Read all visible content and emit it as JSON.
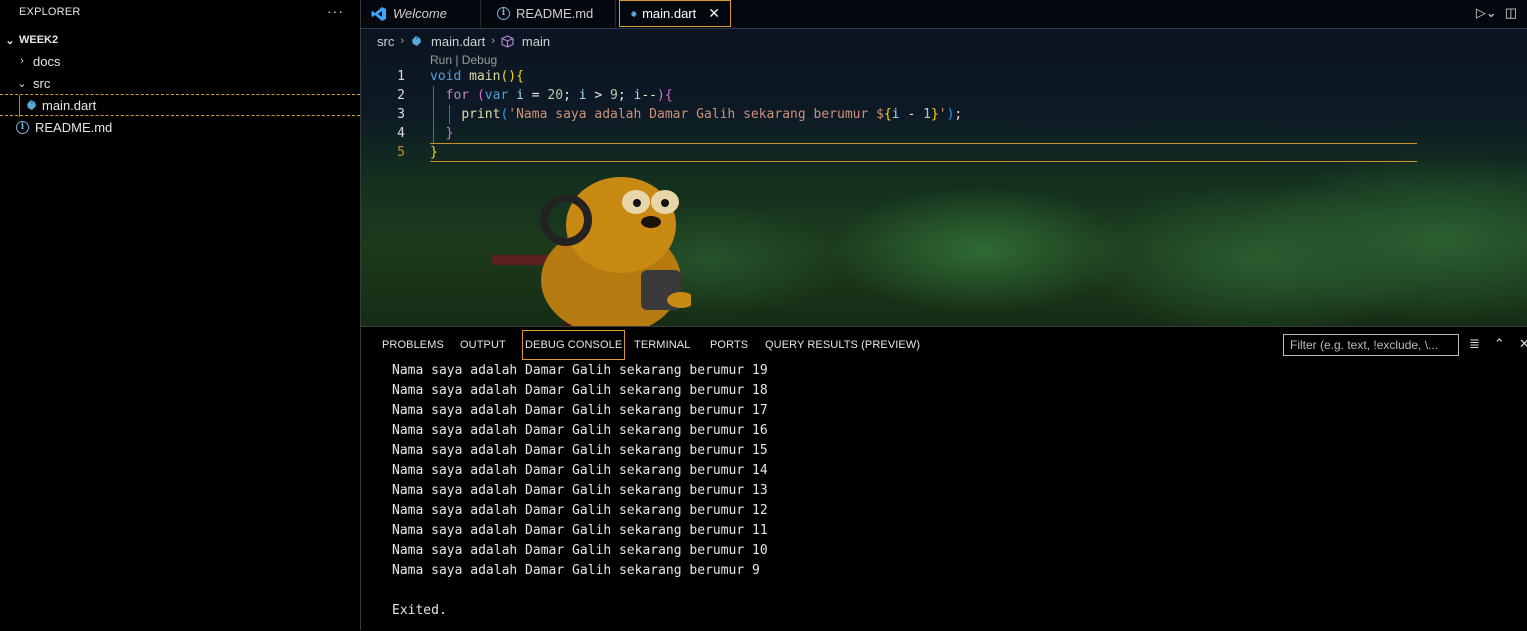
{
  "sidebar": {
    "title": "EXPLORER",
    "more": "···",
    "root": "WEEK2",
    "items": [
      {
        "label": "docs"
      },
      {
        "label": "src"
      },
      {
        "label": "main.dart"
      },
      {
        "label": "README.md"
      }
    ]
  },
  "tabs": [
    {
      "label": "Welcome"
    },
    {
      "label": "README.md"
    },
    {
      "label": "main.dart",
      "close": "✕"
    }
  ],
  "breadcrumb": {
    "folder": "src",
    "file": "main.dart",
    "symbol": "main"
  },
  "editor": {
    "codelens": "Run | Debug",
    "line_numbers": [
      "1",
      "2",
      "3",
      "4",
      "5"
    ],
    "code": {
      "l1_kw": "void",
      "l1_fn": "main",
      "l1_open": "()",
      "l1_brace": "{",
      "l2_kw": "for",
      "l2_p1": "(",
      "l2_var": "var",
      "l2_i": "i",
      "l2_eq": " = ",
      "l2_n1": "20",
      "l2_semi1": "; ",
      "l2_i2": "i",
      "l2_gt": " > ",
      "l2_n2": "9",
      "l2_semi2": "; ",
      "l2_i3": "i",
      "l2_dec": "--",
      "l2_p2": ")",
      "l2_brace": "{",
      "l3_fn": "print",
      "l3_p1": "(",
      "l3_str": "'Nama saya adalah Damar Galih sekarang berumur $",
      "l3_b1": "{",
      "l3_i": "i",
      "l3_minus": " - ",
      "l3_n": "1",
      "l3_b2": "}",
      "l3_q": "'",
      "l3_p2": ")",
      "l3_semi": ";",
      "l4_brace": "}",
      "l5_brace": "}"
    }
  },
  "panel": {
    "tabs": [
      "PROBLEMS",
      "OUTPUT",
      "DEBUG CONSOLE",
      "TERMINAL",
      "PORTS",
      "QUERY RESULTS (PREVIEW)"
    ],
    "filter_placeholder": "Filter (e.g. text, !exclude, \\...",
    "output": [
      "Nama saya adalah Damar Galih sekarang berumur 19",
      "Nama saya adalah Damar Galih sekarang berumur 18",
      "Nama saya adalah Damar Galih sekarang berumur 17",
      "Nama saya adalah Damar Galih sekarang berumur 16",
      "Nama saya adalah Damar Galih sekarang berumur 15",
      "Nama saya adalah Damar Galih sekarang berumur 14",
      "Nama saya adalah Damar Galih sekarang berumur 13",
      "Nama saya adalah Damar Galih sekarang berumur 12",
      "Nama saya adalah Damar Galih sekarang berumur 11",
      "Nama saya adalah Damar Galih sekarang berumur 10",
      "Nama saya adalah Damar Galih sekarang berumur 9",
      "",
      "Exited."
    ]
  },
  "colors": {
    "accent_border": "#d79a34",
    "keyword": "#569cd6",
    "function": "#dcdcaa",
    "string": "#ce9178",
    "number": "#b5cea8"
  }
}
